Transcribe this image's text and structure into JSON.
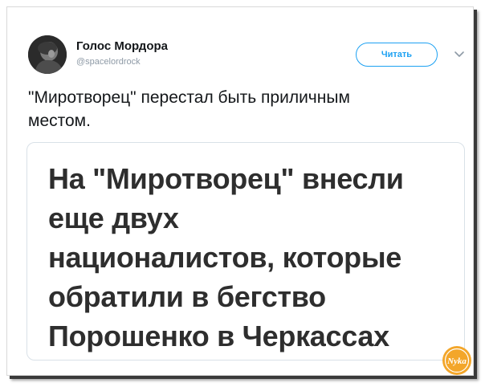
{
  "author": {
    "name": "Голос Мордора",
    "handle": "@spacelordrock"
  },
  "follow_button": {
    "label": "Читать"
  },
  "menu": {
    "icon": "chevron-down-icon"
  },
  "tweet": {
    "lines": [
      "\"Миротворец\" перестал быть приличным",
      "местом."
    ]
  },
  "card": {
    "headline_lines": [
      "На \"Миротворец\" внесли",
      "еще двух",
      "националистов, которые",
      "обратили в бегство",
      "Порошенко в Черкассах"
    ]
  },
  "watermark": {
    "text": "Nyka"
  },
  "colors": {
    "accent": "#1da1f2",
    "text": "#14171a",
    "muted": "#8e9aa6",
    "headline": "#2e2e2e",
    "watermark": "#f0a020"
  }
}
